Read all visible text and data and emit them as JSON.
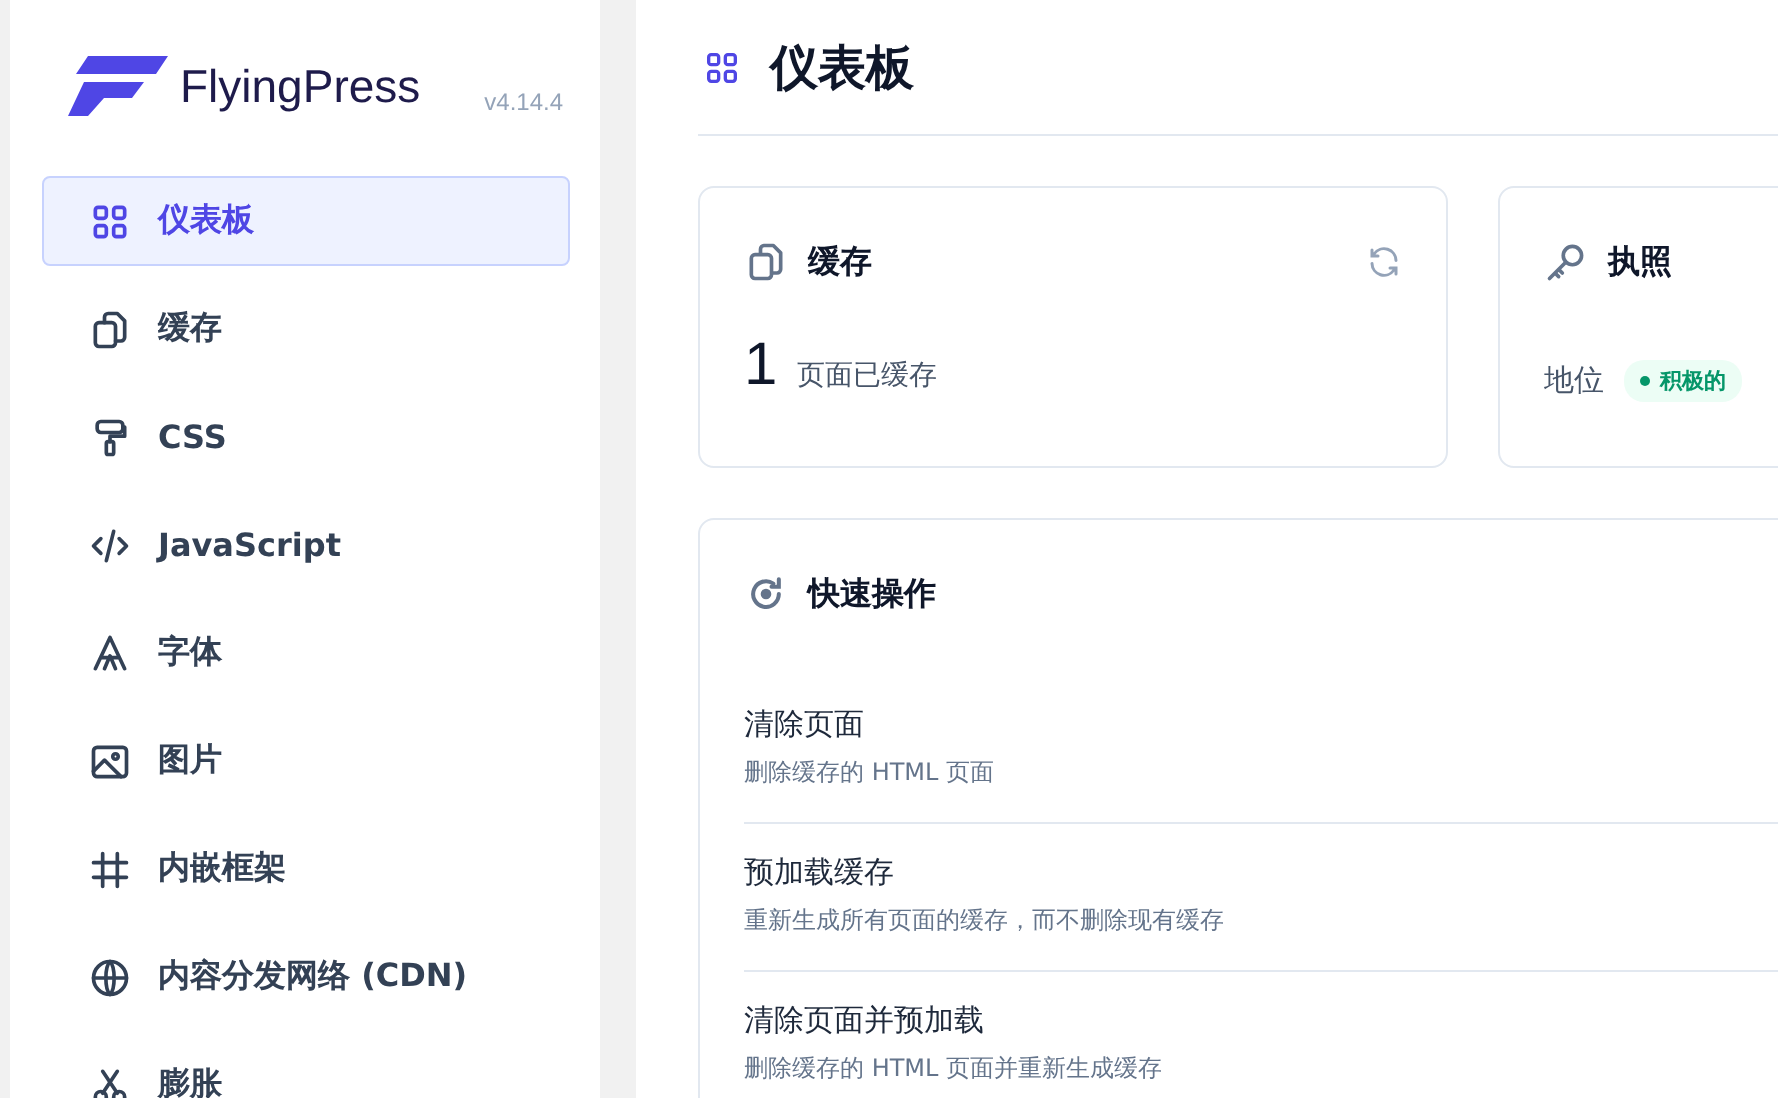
{
  "sidebar": {
    "brand": "FlyingPress",
    "version": "v4.14.4",
    "items": [
      {
        "label": "仪表板",
        "selected": true
      },
      {
        "label": "缓存",
        "selected": false
      },
      {
        "label": "CSS",
        "selected": false
      },
      {
        "label": "JavaScript",
        "selected": false
      },
      {
        "label": "字体",
        "selected": false
      },
      {
        "label": "图片",
        "selected": false
      },
      {
        "label": "内嵌框架",
        "selected": false
      },
      {
        "label": "内容分发网络 (CDN)",
        "selected": false
      },
      {
        "label": "膨胀",
        "selected": false
      }
    ]
  },
  "page": {
    "title": "仪表板"
  },
  "cache_card": {
    "title": "缓存",
    "count": "1",
    "count_label": "页面已缓存"
  },
  "license_card": {
    "title": "执照",
    "status_label": "地位",
    "status": "积极的",
    "active": true
  },
  "quick_actions": {
    "title": "快速操作",
    "actions": [
      {
        "title": "清除页面",
        "description": "删除缓存的 HTML 页面"
      },
      {
        "title": "预加载缓存",
        "description": "重新生成所有页面的缓存，而不删除现有缓存"
      },
      {
        "title": "清除页面并预加载",
        "description": "删除缓存的 HTML 页面并重新生成缓存"
      }
    ]
  }
}
